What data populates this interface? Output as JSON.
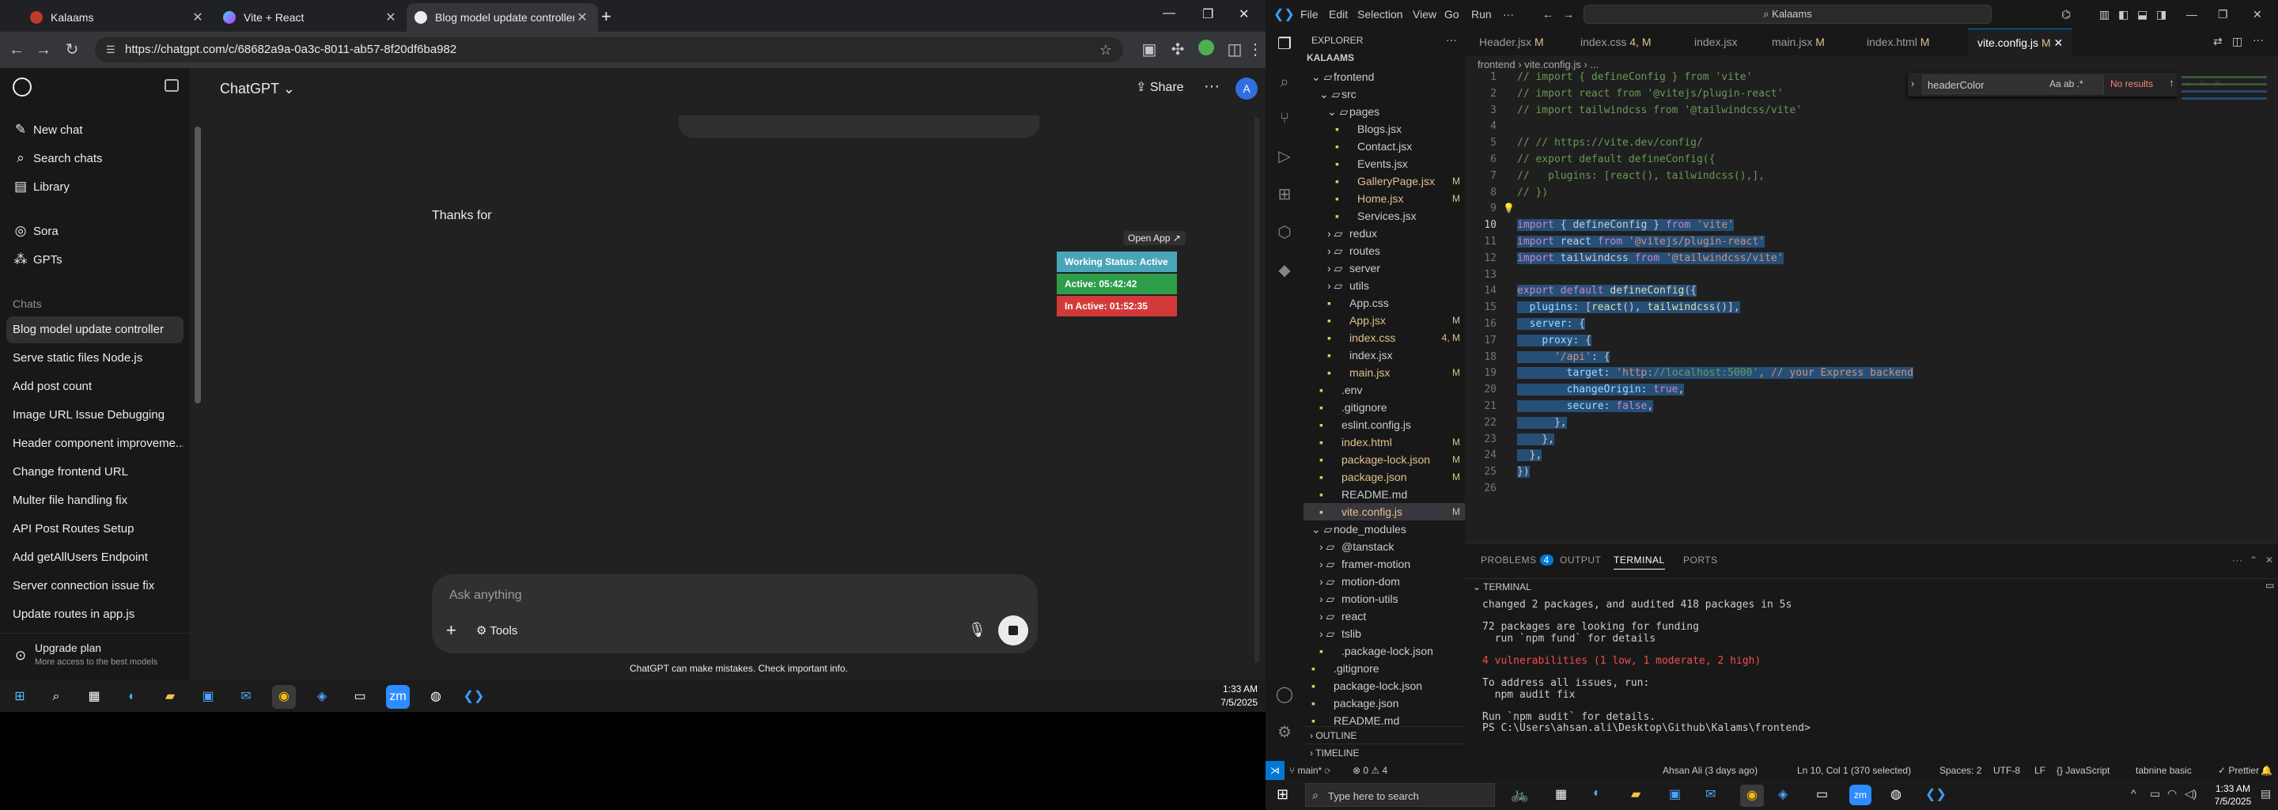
{
  "browser": {
    "tabs": [
      {
        "title": "Kalaams",
        "active": false
      },
      {
        "title": "Vite + React",
        "active": false
      },
      {
        "title": "Blog model update controller",
        "active": true
      }
    ],
    "new_tab": "+",
    "window_controls": [
      "—",
      "❐",
      "✕"
    ],
    "url": "https://chatgpt.com/c/68682a9a-0a3c-8011-ab57-8f20df6ba982"
  },
  "chatgpt": {
    "sidebar": {
      "primary": [
        {
          "label": "New chat",
          "icon": "compose-icon"
        },
        {
          "label": "Search chats",
          "icon": "search-icon"
        },
        {
          "label": "Library",
          "icon": "library-icon"
        },
        {
          "label": "Sora",
          "icon": "sora-icon"
        },
        {
          "label": "GPTs",
          "icon": "gpts-icon"
        }
      ],
      "chats_heading": "Chats",
      "chats": [
        "Blog model update controller",
        "Serve static files Node.js",
        "Add post count",
        "Image URL Issue Debugging",
        "Header component improveme...",
        "Change frontend URL",
        "Multer file handling fix",
        "API Post Routes Setup",
        "Add getAllUsers Endpoint",
        "Server connection issue fix",
        "Update routes in app.js"
      ],
      "upgrade_title": "Upgrade plan",
      "upgrade_sub": "More access to the best models"
    },
    "header": {
      "model": "ChatGPT",
      "share": "Share",
      "avatar": "A"
    },
    "message": "Thanks for",
    "input_placeholder": "Ask anything",
    "tools_label": "Tools",
    "disclaimer": "ChatGPT can make mistakes. Check important info."
  },
  "widget": {
    "open_app": "Open App ↗",
    "status": "Working Status: Active",
    "active": "Active: 05:42:42",
    "inactive": "In Active: 01:52:35",
    "colors": {
      "status": "#4aa5b8",
      "active": "#2e9e4a",
      "inactive": "#d23a3a"
    }
  },
  "left_taskbar": {
    "time": "1:33 AM",
    "date": "7/5/2025"
  },
  "vscode": {
    "menu": [
      "File",
      "Edit",
      "Selection",
      "View",
      "Go",
      "Run",
      "···"
    ],
    "search": "Kalaams",
    "explorer": {
      "title": "EXPLORER",
      "root": "KALAAMS",
      "rows": [
        {
          "label": "frontend",
          "indent": 1,
          "kind": "folder-open",
          "badge": ""
        },
        {
          "label": "src",
          "indent": 2,
          "kind": "folder-open",
          "badge": ""
        },
        {
          "label": "pages",
          "indent": 3,
          "kind": "folder-open",
          "badge": ""
        },
        {
          "label": "Blogs.jsx",
          "indent": 4,
          "kind": "file",
          "badge": ""
        },
        {
          "label": "Contact.jsx",
          "indent": 4,
          "kind": "file",
          "badge": ""
        },
        {
          "label": "Events.jsx",
          "indent": 4,
          "kind": "file",
          "badge": ""
        },
        {
          "label": "GalleryPage.jsx",
          "indent": 4,
          "kind": "file",
          "badge": "M"
        },
        {
          "label": "Home.jsx",
          "indent": 4,
          "kind": "file",
          "badge": "M"
        },
        {
          "label": "Services.jsx",
          "indent": 4,
          "kind": "file",
          "badge": ""
        },
        {
          "label": "redux",
          "indent": 3,
          "kind": "folder",
          "badge": ""
        },
        {
          "label": "routes",
          "indent": 3,
          "kind": "folder",
          "badge": ""
        },
        {
          "label": "server",
          "indent": 3,
          "kind": "folder",
          "badge": ""
        },
        {
          "label": "utils",
          "indent": 3,
          "kind": "folder",
          "badge": ""
        },
        {
          "label": "App.css",
          "indent": 3,
          "kind": "file",
          "badge": ""
        },
        {
          "label": "App.jsx",
          "indent": 3,
          "kind": "file",
          "badge": "M"
        },
        {
          "label": "index.css",
          "indent": 3,
          "kind": "file",
          "badge": "4, M"
        },
        {
          "label": "index.jsx",
          "indent": 3,
          "kind": "file",
          "badge": ""
        },
        {
          "label": "main.jsx",
          "indent": 3,
          "kind": "file",
          "badge": "M"
        },
        {
          "label": ".env",
          "indent": 2,
          "kind": "file",
          "badge": ""
        },
        {
          "label": ".gitignore",
          "indent": 2,
          "kind": "file",
          "badge": ""
        },
        {
          "label": "eslint.config.js",
          "indent": 2,
          "kind": "file",
          "badge": ""
        },
        {
          "label": "index.html",
          "indent": 2,
          "kind": "file",
          "badge": "M"
        },
        {
          "label": "package-lock.json",
          "indent": 2,
          "kind": "file",
          "badge": "M"
        },
        {
          "label": "package.json",
          "indent": 2,
          "kind": "file",
          "badge": "M"
        },
        {
          "label": "README.md",
          "indent": 2,
          "kind": "file",
          "badge": ""
        },
        {
          "label": "vite.config.js",
          "indent": 2,
          "kind": "file",
          "badge": "M"
        },
        {
          "label": "node_modules",
          "indent": 1,
          "kind": "folder-open",
          "badge": ""
        },
        {
          "label": "@tanstack",
          "indent": 2,
          "kind": "folder",
          "badge": ""
        },
        {
          "label": "framer-motion",
          "indent": 2,
          "kind": "folder",
          "badge": ""
        },
        {
          "label": "motion-dom",
          "indent": 2,
          "kind": "folder",
          "badge": ""
        },
        {
          "label": "motion-utils",
          "indent": 2,
          "kind": "folder",
          "badge": ""
        },
        {
          "label": "react",
          "indent": 2,
          "kind": "folder",
          "badge": ""
        },
        {
          "label": "tslib",
          "indent": 2,
          "kind": "folder",
          "badge": ""
        },
        {
          "label": ".package-lock.json",
          "indent": 2,
          "kind": "file",
          "badge": ""
        },
        {
          "label": ".gitignore",
          "indent": 1,
          "kind": "file",
          "badge": ""
        },
        {
          "label": "package-lock.json",
          "indent": 1,
          "kind": "file",
          "badge": ""
        },
        {
          "label": "package.json",
          "indent": 1,
          "kind": "file",
          "badge": ""
        },
        {
          "label": "README.md",
          "indent": 1,
          "kind": "file",
          "badge": ""
        }
      ],
      "outline": "OUTLINE",
      "timeline": "TIMELINE"
    },
    "editor_tabs": [
      {
        "label": "Header.jsx",
        "badge": "M"
      },
      {
        "label": "index.css",
        "badge": "4, M"
      },
      {
        "label": "index.jsx",
        "badge": ""
      },
      {
        "label": "main.jsx",
        "badge": "M"
      },
      {
        "label": "index.html",
        "badge": "M"
      },
      {
        "label": "vite.config.js",
        "badge": "M"
      }
    ],
    "breadcrumb": "frontend › vite.config.js › ...",
    "find": {
      "query": "headerColor",
      "result": "No results"
    },
    "code_lines": [
      "// import { defineConfig } from 'vite'",
      "// import react from '@vitejs/plugin-react'",
      "// import tailwindcss from '@tailwindcss/vite'",
      "",
      "// // https://vite.dev/config/",
      "// export default defineConfig({",
      "//   plugins: [react(), tailwindcss(),],",
      "// })",
      "",
      "import { defineConfig } from 'vite'",
      "import react from '@vitejs/plugin-react'",
      "import tailwindcss from '@tailwindcss/vite'",
      "",
      "export default defineConfig({",
      "  plugins: [react(), tailwindcss()],",
      "  server: {",
      "    proxy: {",
      "      '/api': {",
      "        target: 'http://localhost:5000', // your Express backend",
      "        changeOrigin: true,",
      "        secure: false,",
      "      },",
      "    },",
      "  },",
      "})",
      ""
    ],
    "panel": {
      "tabs": [
        {
          "label": "PROBLEMS",
          "badge": "4"
        },
        {
          "label": "OUTPUT",
          "badge": ""
        },
        {
          "label": "TERMINAL",
          "badge": ""
        },
        {
          "label": "PORTS",
          "badge": ""
        }
      ],
      "terminal_title": "TERMINAL",
      "terminal_lines": [
        "changed 2 packages, and audited 418 packages in 5s",
        "",
        "72 packages are looking for funding",
        "  run `npm fund` for details",
        "",
        "4 vulnerabilities (1 low, 1 moderate, 2 high)",
        "",
        "To address all issues, run:",
        "  npm audit fix",
        "",
        "Run `npm audit` for details.",
        "PS C:\\Users\\ahsan.ali\\Desktop\\Github\\Kalams\\frontend> "
      ]
    },
    "status": {
      "branch": "main*",
      "errors": "⊗ 0 ⚠ 4",
      "blame": "Ahsan Ali (3 days ago)",
      "position": "Ln 10, Col 1 (370 selected)",
      "spaces": "Spaces: 2",
      "encoding": "UTF-8",
      "eol": "LF",
      "language": "JavaScript",
      "tabnine": "tabnine basic",
      "prettier": "✓ Prettier"
    }
  },
  "windows_taskbar": {
    "search_placeholder": "Type here to search",
    "time": "1:33 AM",
    "date": "7/5/2025"
  }
}
